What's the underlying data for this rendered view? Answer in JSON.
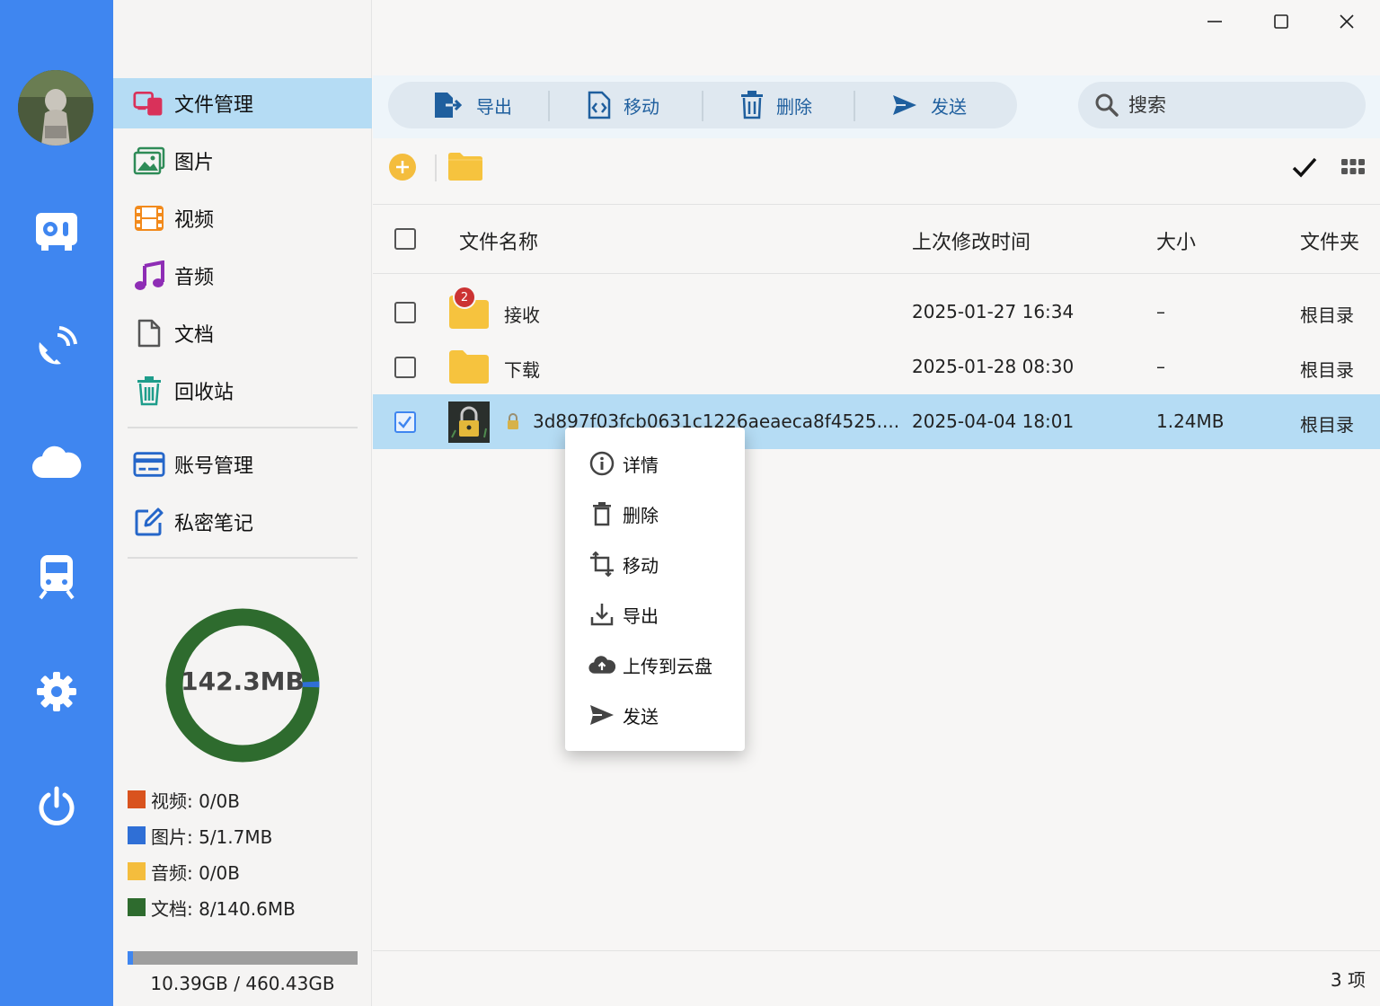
{
  "window": {
    "controls": [
      "minimize",
      "maximize",
      "close"
    ]
  },
  "rail": {
    "items": [
      {
        "name": "safe",
        "icon": "safe-icon"
      },
      {
        "name": "transfer",
        "icon": "satellite-dish-icon"
      },
      {
        "name": "cloud",
        "icon": "cloud-icon"
      },
      {
        "name": "train",
        "icon": "train-icon"
      },
      {
        "name": "settings",
        "icon": "gear-icon"
      },
      {
        "name": "power",
        "icon": "power-icon"
      }
    ]
  },
  "sidebar": {
    "items": [
      {
        "label": "文件管理",
        "icon": "file-manager-icon",
        "active": true
      },
      {
        "label": "图片",
        "icon": "image-icon"
      },
      {
        "label": "视频",
        "icon": "film-icon"
      },
      {
        "label": "音频",
        "icon": "music-icon"
      },
      {
        "label": "文档",
        "icon": "document-icon"
      },
      {
        "label": "回收站",
        "icon": "trash-icon"
      }
    ],
    "items2": [
      {
        "label": "账号管理",
        "icon": "card-icon"
      },
      {
        "label": "私密笔记",
        "icon": "edit-note-icon"
      }
    ]
  },
  "storage": {
    "used_label": "142.3MB",
    "legend": [
      {
        "label": "视频: 0/0B",
        "color": "#d9531e"
      },
      {
        "label": "图片: 5/1.7MB",
        "color": "#2f6fd6"
      },
      {
        "label": "音频: 0/0B",
        "color": "#f4bd3d"
      },
      {
        "label": "文档: 8/140.6MB",
        "color": "#2e6b2e"
      }
    ],
    "disk_text": "10.39GB / 460.43GB",
    "disk_used": 10.39,
    "disk_total": 460.43
  },
  "toolbar": {
    "export_label": "导出",
    "move_label": "移动",
    "delete_label": "删除",
    "send_label": "发送",
    "search_placeholder": "搜索"
  },
  "table": {
    "headers": {
      "name": "文件名称",
      "modified": "上次修改时间",
      "size": "大小",
      "folder": "文件夹"
    },
    "rows": [
      {
        "name": "接收",
        "modified": "2025-01-27 16:34",
        "size": "–",
        "folder": "根目录",
        "type": "folder",
        "badge": "2",
        "selected": false
      },
      {
        "name": "下载",
        "modified": "2025-01-28 08:30",
        "size": "–",
        "folder": "根目录",
        "type": "folder",
        "selected": false
      },
      {
        "name": "3d897f03fcb0631c1226aeaeca8f4525....",
        "modified": "2025-04-04 18:01",
        "size": "1.24MB",
        "folder": "根目录",
        "type": "image",
        "locked": true,
        "selected": true
      }
    ]
  },
  "context_menu": {
    "items": [
      {
        "label": "详情",
        "icon": "info-icon"
      },
      {
        "label": "删除",
        "icon": "trash-icon"
      },
      {
        "label": "移动",
        "icon": "crop-move-icon"
      },
      {
        "label": "导出",
        "icon": "download-icon"
      },
      {
        "label": "上传到云盘",
        "icon": "cloud-upload-icon"
      },
      {
        "label": "发送",
        "icon": "send-icon"
      }
    ]
  },
  "footer": {
    "count": "3 项"
  },
  "colors": {
    "rail": "#3f86f0",
    "active": "#b5dcf4",
    "donut": "#2e6b2e"
  }
}
